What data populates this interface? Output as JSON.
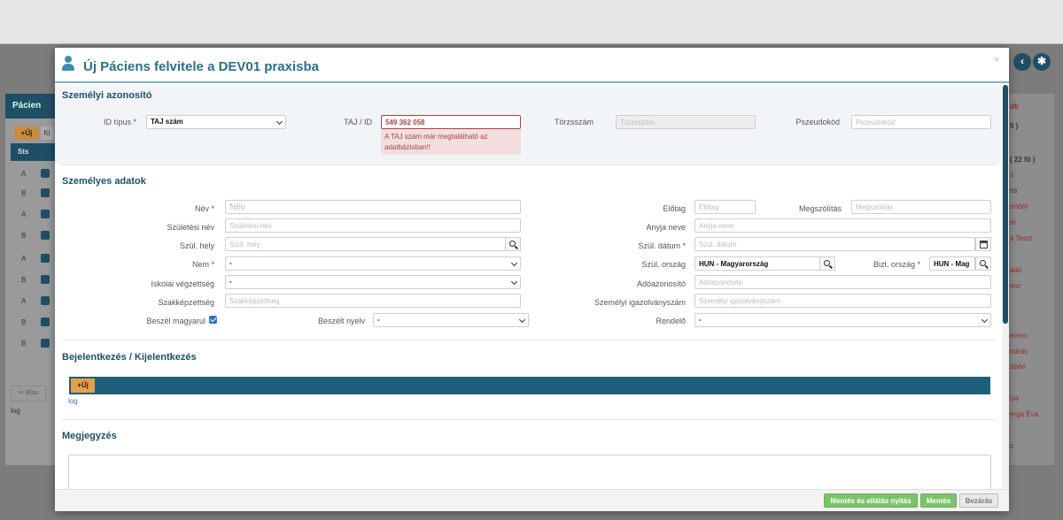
{
  "background": {
    "left_panel_title": "Pácien",
    "new_label": "+Új",
    "new2_label": "Ki",
    "sts_header": "Sts",
    "rows": [
      "A",
      "B",
      "A",
      "B",
      "A",
      "B",
      "A",
      "B",
      "B"
    ],
    "filter_label": "✂ Elso",
    "log_label": "log",
    "right_texts": [
      "db",
      "5 )",
      "( 22 fő )",
      "s",
      "ns",
      "endre",
      "ér",
      "a Teszt",
      "ádó",
      "enc",
      "erenc",
      "ndrás",
      "abán",
      "iya",
      "erga Éva",
      "c"
    ]
  },
  "modal": {
    "title": "Új Páciens felvitele a DEV01 praxisba",
    "close": "×",
    "sections": {
      "identity": "Személyi azonosító",
      "personal": "Személyes adatok",
      "login": "Bejelentkezés / Kijelentkezés",
      "note": "Megjegyzés"
    },
    "identity": {
      "id_type_label": "ID típus *",
      "id_type_value": "TAJ szám",
      "taj_label": "TAJ / ID",
      "taj_value": "549 362 058",
      "taj_error": "A TAJ szám már megtalálható az adatbázisban!!",
      "torzsszam_label": "Törzsszám",
      "torzsszam_placeholder": "Törzsszám",
      "pseudo_label": "Pszeudokód",
      "pseudo_placeholder": "Pszeudokód"
    },
    "personal": {
      "nev_label": "Név *",
      "nev_ph": "Név",
      "eloTag_label": "Előtag",
      "eloTag_ph": "Előtag",
      "megszolitas_label": "Megszólítás",
      "megszolitas_ph": "Megszólítás",
      "szulnev_label": "Születési név",
      "szulnev_ph": "Születési név",
      "anyja_label": "Anyja neve",
      "anyja_ph": "Anyja neve",
      "szulhely_label": "Szül. hely",
      "szulhely_ph": "Szül. hely",
      "szuldatum_label": "Szül. dátum *",
      "szuldatum_ph": "Szül. dátum",
      "nem_label": "Nem *",
      "nem_value": "-",
      "szulorszag_label": "Szül. ország",
      "szulorszag_value": "HUN - Magyarország",
      "biztorszag_label": "Bizt. ország *",
      "biztorszag_value": "HUN - Mag",
      "iskolai_label": "Iskolai végzettség",
      "iskolai_value": "-",
      "adoazon_label": "Adóazonosító",
      "adoazon_ph": "Adóazonosító",
      "szakkep_label": "Szakképzettség",
      "szakkep_ph": "Szakképzettség",
      "szemig_label": "Személyi igazolványszám",
      "szemig_ph": "Személyi igazolványszám",
      "beszel_label": "Beszél magyarul",
      "nyelv_label": "Beszélt nyelv",
      "nyelv_value": "-",
      "rendelo_label": "Rendelő",
      "rendelo_value": "-"
    },
    "login": {
      "new_label": "+Új",
      "log_link": "log"
    },
    "footer": {
      "save_and_open": "Mentés és ellátás nyitás",
      "save": "Mentés",
      "close": "Bezárás"
    }
  }
}
